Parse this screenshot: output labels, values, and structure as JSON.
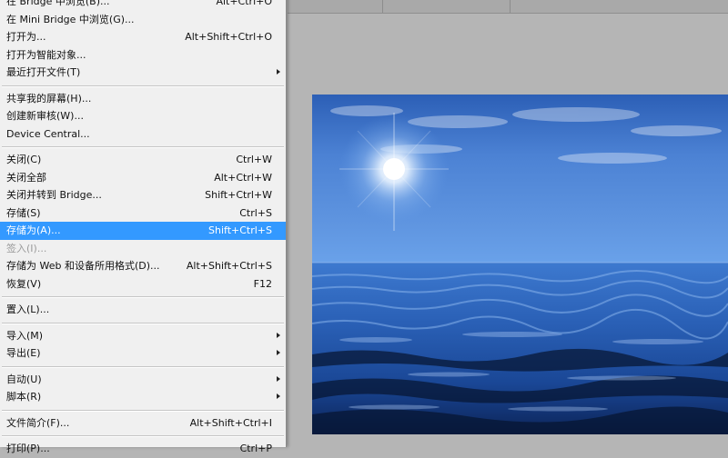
{
  "menu": {
    "items": [
      {
        "label": "在 Bridge 中浏览(B)...",
        "shortcut": "Alt+Ctrl+O"
      },
      {
        "label": "在 Mini Bridge 中浏览(G)...",
        "shortcut": ""
      },
      {
        "label": "打开为...",
        "shortcut": "Alt+Shift+Ctrl+O"
      },
      {
        "label": "打开为智能对象...",
        "shortcut": ""
      },
      {
        "label": "最近打开文件(T)",
        "shortcut": "",
        "submenu": true
      },
      {
        "separator": true
      },
      {
        "label": "共享我的屏幕(H)...",
        "shortcut": ""
      },
      {
        "label": "创建新审核(W)...",
        "shortcut": ""
      },
      {
        "label": "Device Central...",
        "shortcut": ""
      },
      {
        "separator": true
      },
      {
        "label": "关闭(C)",
        "shortcut": "Ctrl+W"
      },
      {
        "label": "关闭全部",
        "shortcut": "Alt+Ctrl+W"
      },
      {
        "label": "关闭并转到 Bridge...",
        "shortcut": "Shift+Ctrl+W"
      },
      {
        "label": "存储(S)",
        "shortcut": "Ctrl+S"
      },
      {
        "label": "存储为(A)...",
        "shortcut": "Shift+Ctrl+S",
        "highlight": true
      },
      {
        "label": "签入(I)...",
        "shortcut": "",
        "disabled": true
      },
      {
        "label": "存储为 Web 和设备所用格式(D)...",
        "shortcut": "Alt+Shift+Ctrl+S"
      },
      {
        "label": "恢复(V)",
        "shortcut": "F12"
      },
      {
        "separator": true
      },
      {
        "label": "置入(L)...",
        "shortcut": ""
      },
      {
        "separator": true
      },
      {
        "label": "导入(M)",
        "shortcut": "",
        "submenu": true
      },
      {
        "label": "导出(E)",
        "shortcut": "",
        "submenu": true
      },
      {
        "separator": true
      },
      {
        "label": "自动(U)",
        "shortcut": "",
        "submenu": true
      },
      {
        "label": "脚本(R)",
        "shortcut": "",
        "submenu": true
      },
      {
        "separator": true
      },
      {
        "label": "文件简介(F)...",
        "shortcut": "Alt+Shift+Ctrl+I"
      },
      {
        "separator": true
      },
      {
        "label": "打印(P)...",
        "shortcut": "Ctrl+P"
      }
    ]
  },
  "canvas": {
    "description_icon": "image"
  },
  "colors": {
    "highlight": "#3399ff",
    "menu_bg": "#f0f0f0",
    "workspace_bg": "#b5b5b5"
  }
}
